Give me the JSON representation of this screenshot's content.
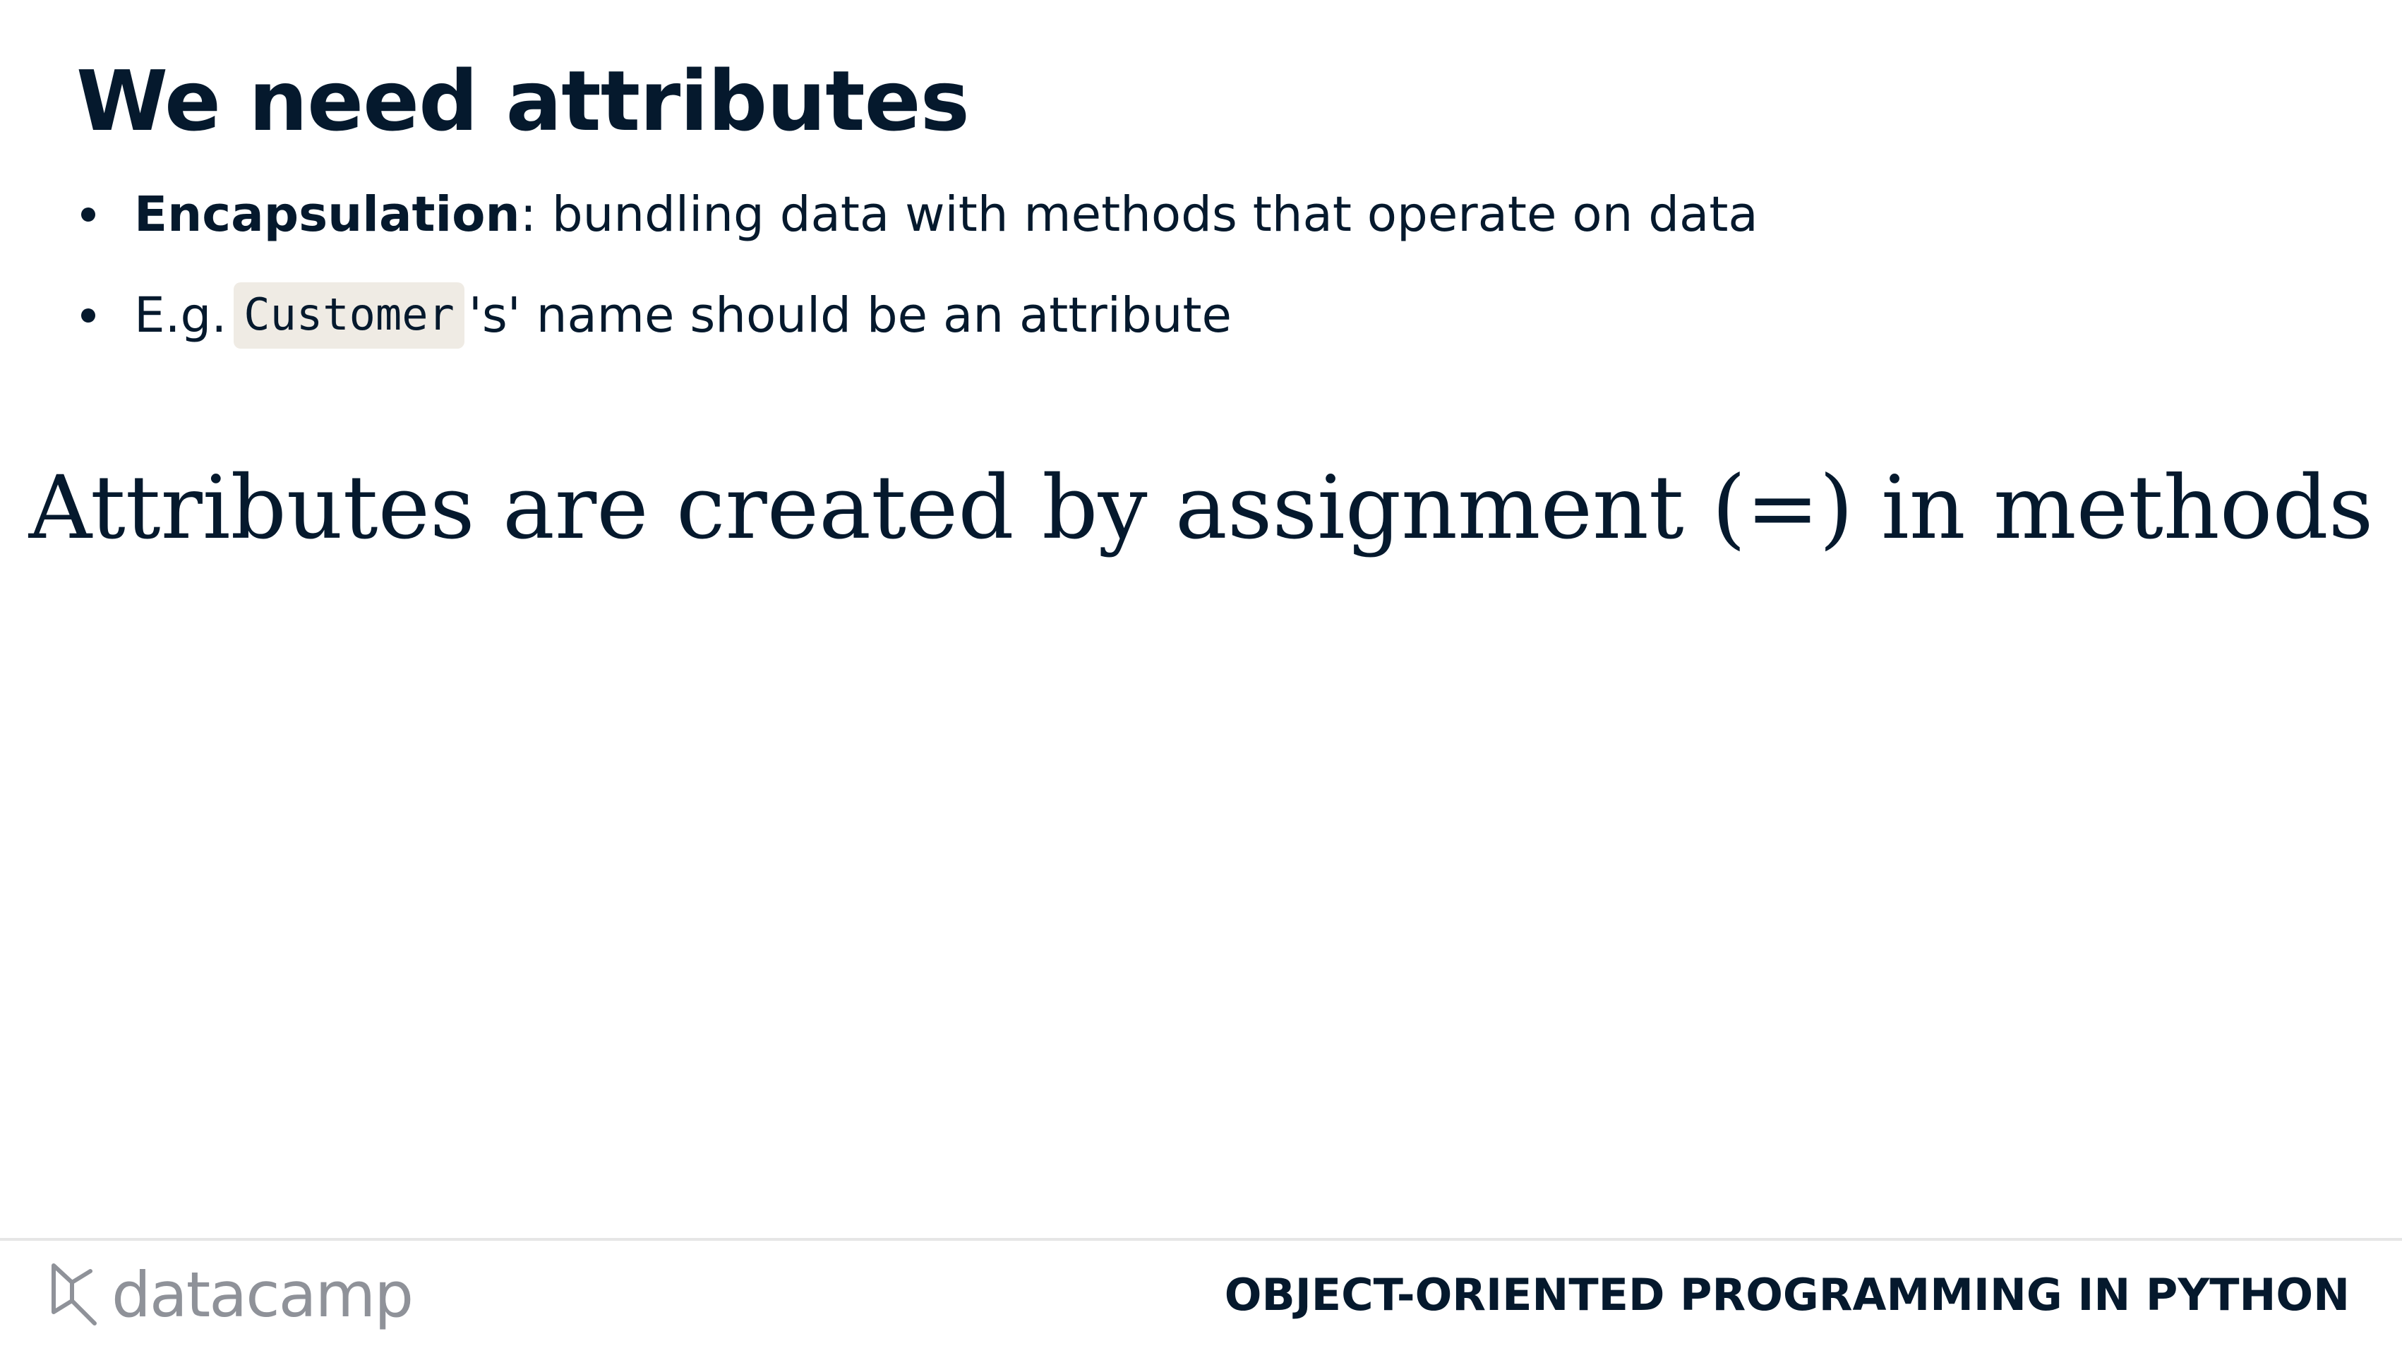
{
  "slide": {
    "title": "We need attributes",
    "bullets": [
      {
        "term": "Encapsulation",
        "colon": ":",
        "text": " bundling data with methods that operate on data"
      },
      {
        "prefix": "E.g.",
        "code": "Customer",
        "suffix": "'s' name should be an attribute"
      }
    ],
    "statement": "Attributes are created by assignment (=) in methods"
  },
  "footer": {
    "brand": "datacamp",
    "course": "OBJECT-ORIENTED PROGRAMMING IN PYTHON"
  },
  "colors": {
    "text": "#05192d",
    "code_background": "#efebe4",
    "brand_gray": "#8f9299",
    "footer_rule": "#e6e6e6"
  },
  "icons": {
    "brand_logo": "datacamp-logo-icon"
  }
}
